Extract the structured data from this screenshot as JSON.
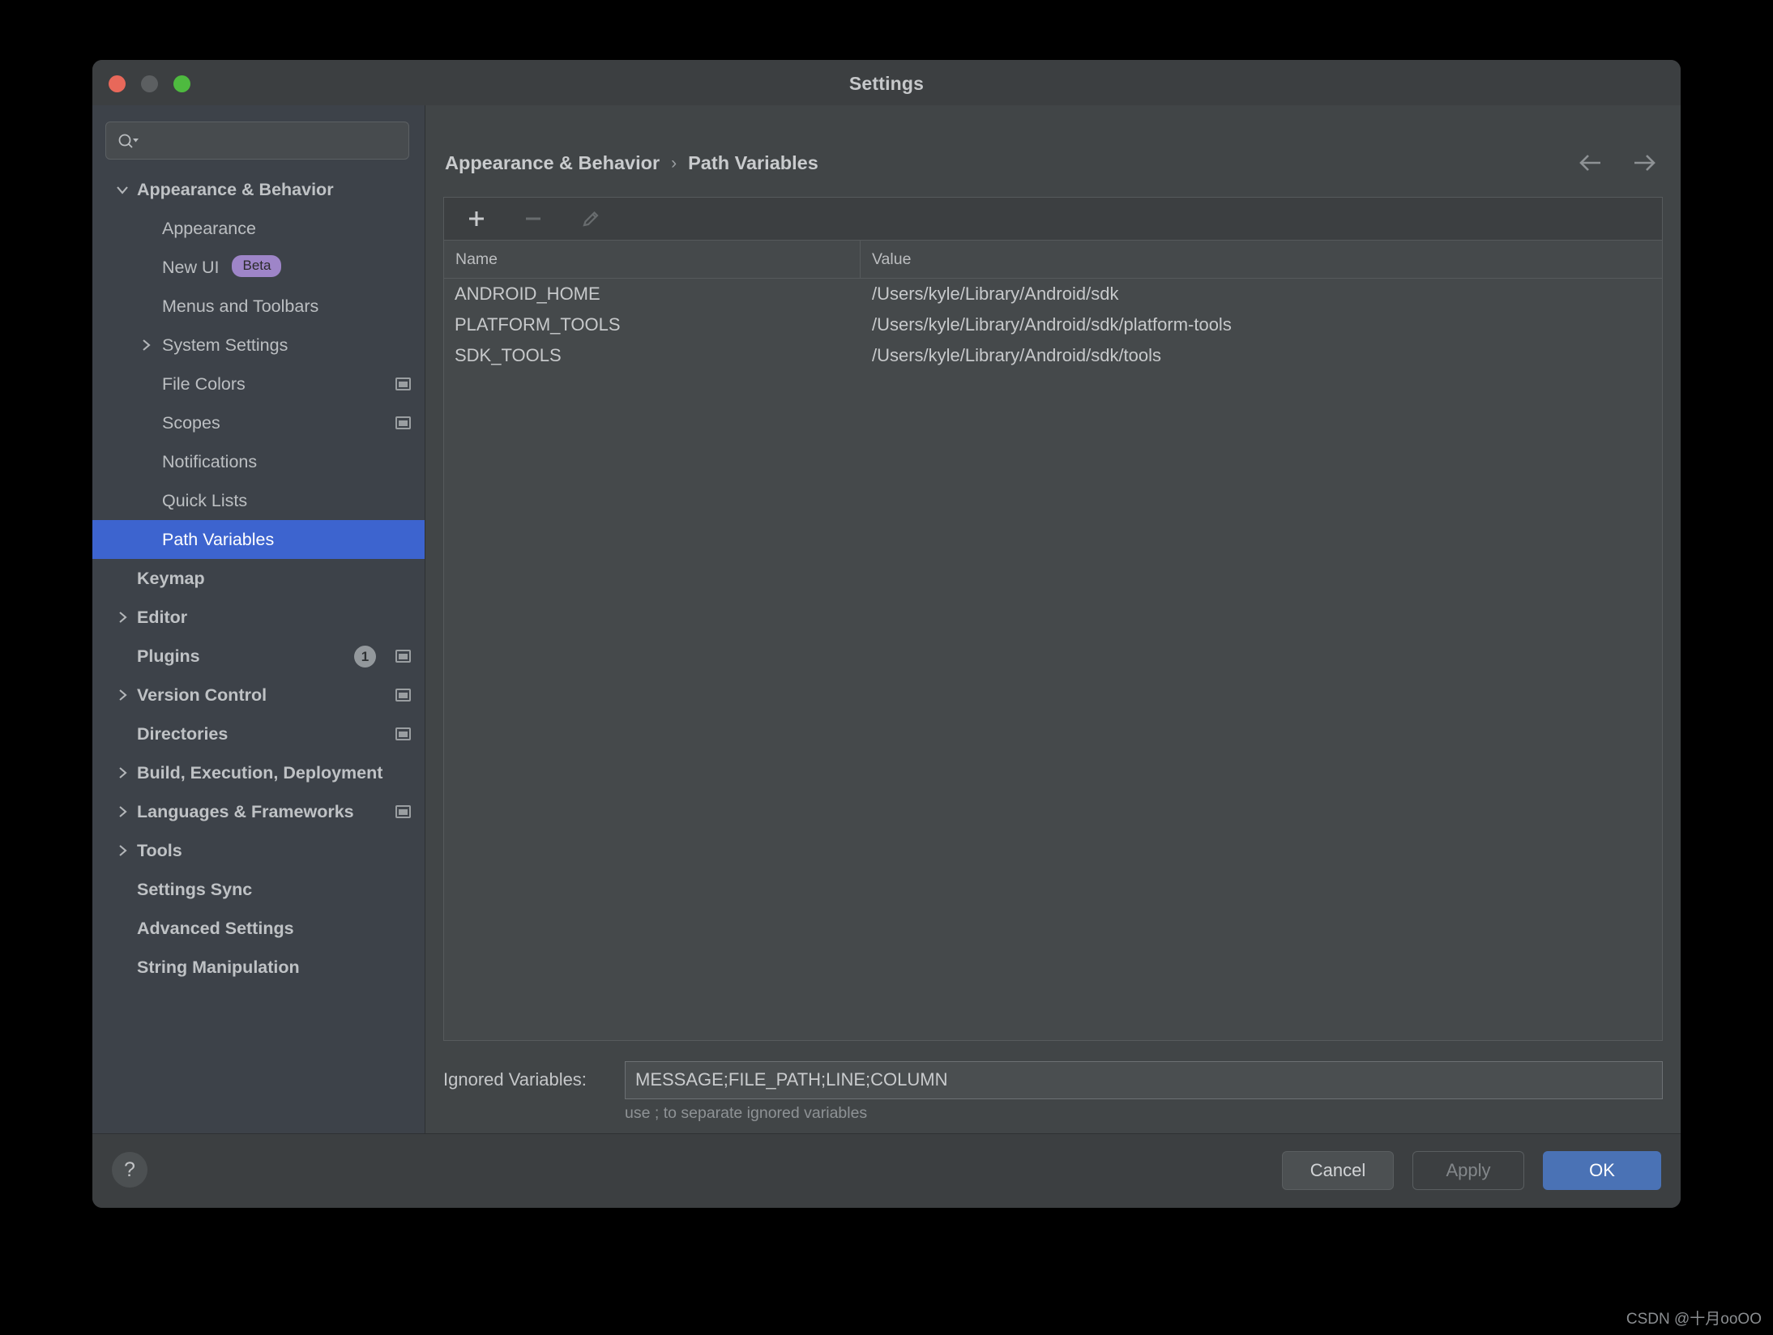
{
  "window": {
    "title": "Settings",
    "traffic_lights": [
      "close",
      "minimize",
      "zoom"
    ]
  },
  "sidebar": {
    "search": {
      "value": "",
      "placeholder": ""
    },
    "items": [
      {
        "label": "Appearance & Behavior",
        "level": 0,
        "bold": true,
        "chevron": "down",
        "selected": false
      },
      {
        "label": "Appearance",
        "level": 1,
        "bold": false,
        "chevron": "",
        "selected": false
      },
      {
        "label": "New UI",
        "level": 1,
        "bold": false,
        "chevron": "",
        "selected": false,
        "badge": "Beta"
      },
      {
        "label": "Menus and Toolbars",
        "level": 1,
        "bold": false,
        "chevron": "",
        "selected": false
      },
      {
        "label": "System Settings",
        "level": 1,
        "bold": false,
        "chevron": "right",
        "selected": false
      },
      {
        "label": "File Colors",
        "level": 1,
        "bold": false,
        "chevron": "",
        "selected": false,
        "project_icon": true
      },
      {
        "label": "Scopes",
        "level": 1,
        "bold": false,
        "chevron": "",
        "selected": false,
        "project_icon": true
      },
      {
        "label": "Notifications",
        "level": 1,
        "bold": false,
        "chevron": "",
        "selected": false
      },
      {
        "label": "Quick Lists",
        "level": 1,
        "bold": false,
        "chevron": "",
        "selected": false
      },
      {
        "label": "Path Variables",
        "level": 1,
        "bold": false,
        "chevron": "",
        "selected": true
      },
      {
        "label": "Keymap",
        "level": 0,
        "bold": true,
        "chevron": "",
        "selected": false
      },
      {
        "label": "Editor",
        "level": 0,
        "bold": true,
        "chevron": "right",
        "selected": false
      },
      {
        "label": "Plugins",
        "level": 0,
        "bold": true,
        "chevron": "",
        "selected": false,
        "count": "1",
        "project_icon": true
      },
      {
        "label": "Version Control",
        "level": 0,
        "bold": true,
        "chevron": "right",
        "selected": false,
        "project_icon": true
      },
      {
        "label": "Directories",
        "level": 0,
        "bold": true,
        "chevron": "",
        "selected": false,
        "project_icon": true
      },
      {
        "label": "Build, Execution, Deployment",
        "level": 0,
        "bold": true,
        "chevron": "right",
        "selected": false
      },
      {
        "label": "Languages & Frameworks",
        "level": 0,
        "bold": true,
        "chevron": "right",
        "selected": false,
        "project_icon": true
      },
      {
        "label": "Tools",
        "level": 0,
        "bold": true,
        "chevron": "right",
        "selected": false
      },
      {
        "label": "Settings Sync",
        "level": 0,
        "bold": true,
        "chevron": "",
        "selected": false
      },
      {
        "label": "Advanced Settings",
        "level": 0,
        "bold": true,
        "chevron": "",
        "selected": false
      },
      {
        "label": "String Manipulation",
        "level": 0,
        "bold": true,
        "chevron": "",
        "selected": false
      }
    ]
  },
  "content": {
    "breadcrumb": {
      "root": "Appearance & Behavior",
      "separator": "›",
      "leaf": "Path Variables"
    },
    "nav": {
      "back": "back-arrow",
      "forward": "forward-arrow"
    },
    "toolbar": [
      {
        "name": "add",
        "glyph": "+",
        "enabled": true
      },
      {
        "name": "remove",
        "glyph": "−",
        "enabled": false
      },
      {
        "name": "edit",
        "glyph": "pencil",
        "enabled": false
      }
    ],
    "table": {
      "columns": [
        "Name",
        "Value"
      ],
      "rows": [
        {
          "name": "ANDROID_HOME",
          "value": "/Users/kyle/Library/Android/sdk"
        },
        {
          "name": "PLATFORM_TOOLS",
          "value": "/Users/kyle/Library/Android/sdk/platform-tools"
        },
        {
          "name": "SDK_TOOLS",
          "value": "/Users/kyle/Library/Android/sdk/tools"
        }
      ]
    },
    "ignored": {
      "label": "Ignored Variables:",
      "value": "MESSAGE;FILE_PATH;LINE;COLUMN",
      "hint": "use ; to separate ignored variables"
    }
  },
  "footer": {
    "help": "?",
    "cancel": "Cancel",
    "apply": "Apply",
    "ok": "OK"
  },
  "watermark": "CSDN @十月ooOO",
  "colors": {
    "selection_blue": "#3d64cf",
    "ok_button_blue": "#4a72b5",
    "beta_badge": "#9e85c8",
    "sidebar_bg": "#3d4249",
    "content_bg": "#414547",
    "panel_bg": "#45494b",
    "chrome_bg": "#3c3f41"
  }
}
